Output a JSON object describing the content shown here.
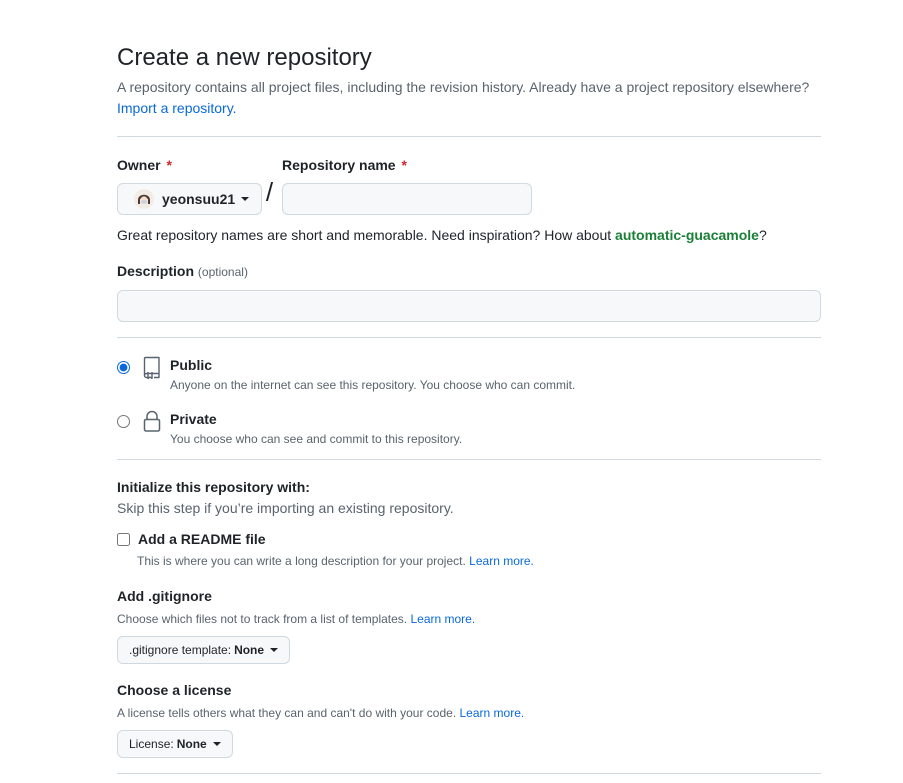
{
  "header": {
    "title": "Create a new repository",
    "subtitle": "A repository contains all project files, including the revision history. Already have a project repository elsewhere?",
    "import_link": "Import a repository."
  },
  "owner": {
    "label": "Owner",
    "required_mark": "*",
    "value": "yeonsuu21",
    "avatar_icon": "user-avatar"
  },
  "repo_name": {
    "label": "Repository name",
    "required_mark": "*",
    "value": "",
    "separator": "/"
  },
  "name_hint": {
    "prefix": "Great repository names are short and memorable. Need inspiration? How about ",
    "suggestion": "automatic-guacamole",
    "suffix": "?"
  },
  "description": {
    "label": "Description",
    "optional": "(optional)",
    "value": ""
  },
  "visibility": {
    "selected": "public",
    "options": [
      {
        "id": "public",
        "title": "Public",
        "desc": "Anyone on the internet can see this repository. You choose who can commit.",
        "icon": "repo-icon"
      },
      {
        "id": "private",
        "title": "Private",
        "desc": "You choose who can see and commit to this repository.",
        "icon": "lock-icon"
      }
    ]
  },
  "initialize": {
    "title": "Initialize this repository with:",
    "subtitle": "Skip this step if you’re importing an existing repository.",
    "readme": {
      "label": "Add a README file",
      "checked": false,
      "desc": "This is where you can write a long description for your project.",
      "learn_more": "Learn more."
    }
  },
  "gitignore": {
    "title": "Add .gitignore",
    "desc": "Choose which files not to track from a list of templates.",
    "learn_more": "Learn more.",
    "button_prefix": ".gitignore template:",
    "button_value": "None"
  },
  "license": {
    "title": "Choose a license",
    "desc": "A license tells others what they can and can't do with your code.",
    "learn_more": "Learn more.",
    "button_prefix": "License:",
    "button_value": "None"
  },
  "colors": {
    "accent": "#0969da",
    "suggestion": "#1a7f37",
    "required": "#d1242f",
    "border": "#d1d9e0"
  }
}
